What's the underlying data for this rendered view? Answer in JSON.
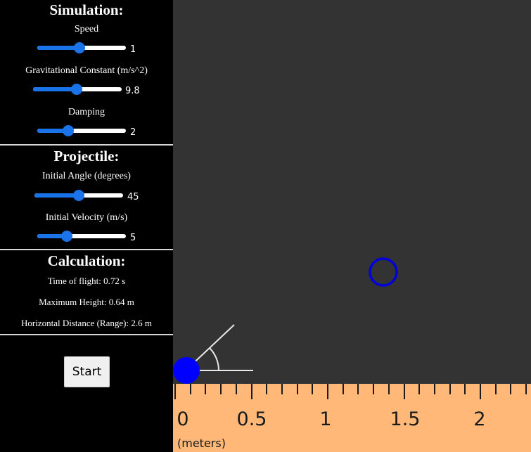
{
  "simulation": {
    "title": "Simulation:",
    "speed": {
      "label": "Speed",
      "value": "1",
      "fraction": 0.48
    },
    "gravity": {
      "label": "Gravitational Constant (m/s^2)",
      "value": "9.8",
      "fraction": 0.49
    },
    "damping": {
      "label": "Damping",
      "value": "2",
      "fraction": 0.35
    }
  },
  "projectile": {
    "title": "Projectile:",
    "angle": {
      "label": "Initial Angle (degrees)",
      "value": "45",
      "fraction": 0.5
    },
    "velocity": {
      "label": "Initial Velocity (m/s)",
      "value": "5",
      "fraction": 0.33
    }
  },
  "calculation": {
    "title": "Calculation:",
    "time_of_flight": "Time of flight: 0.72 s",
    "max_height": "Maximum Height: 0.64 m",
    "range": "Horizontal Distance (Range): 2.6 m"
  },
  "controls": {
    "start_label": "Start"
  },
  "ruler": {
    "unit_label": "(meters)",
    "tick_labels": [
      "0",
      "0.5",
      "1",
      "1.5",
      "2"
    ]
  },
  "colors": {
    "sidebar": "#000000",
    "canvas": "#333333",
    "ruler": "#ffb877",
    "accent": "#1a73e8",
    "projectile": "#0000ff",
    "target_ring": "#0000dd"
  },
  "icons": {
    "projectile": "filled-circle",
    "target": "ring-circle",
    "angle_indicator": "angle-arc"
  }
}
